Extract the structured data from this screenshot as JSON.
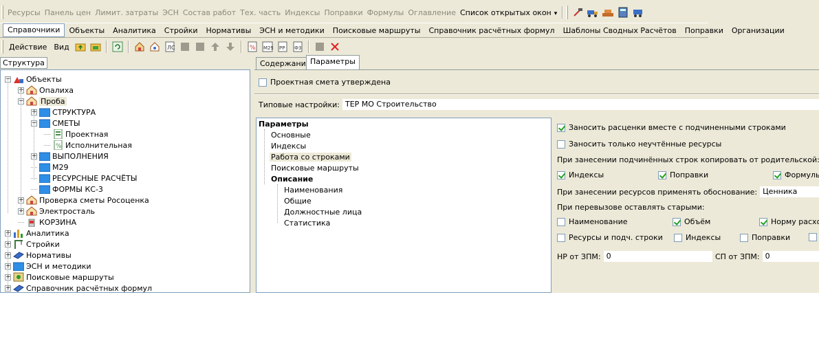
{
  "toolbar1": {
    "items": [
      "Ресурсы",
      "Панель цен",
      "Лимит. затраты",
      "ЭСН",
      "Состав работ",
      "Тех. часть",
      "Индексы",
      "Поправки",
      "Формулы",
      "Оглавление"
    ],
    "open_windows": "Список открытых окон"
  },
  "menu2": {
    "items": [
      "Справочники",
      "Объекты",
      "Аналитика",
      "Стройки",
      "Нормативы",
      "ЭСН и методики",
      "Поисковые маршруты",
      "Справочник расчётных формул",
      "Шаблоны Сводных Расчётов",
      "Поправки",
      "Организации"
    ]
  },
  "toolbar3": {
    "action": "Действие",
    "view": "Вид"
  },
  "left_tab": "Структура",
  "tree": [
    {
      "label": "Объекты",
      "level": 0,
      "exp": "-",
      "icon": "objects-icon"
    },
    {
      "label": "Опалиха",
      "level": 1,
      "exp": "+",
      "icon": "house-icon"
    },
    {
      "label": "Проба",
      "level": 1,
      "exp": "-",
      "icon": "house-icon",
      "selected": true
    },
    {
      "label": "СТРУКТУРА",
      "level": 2,
      "exp": "+",
      "icon": "folder-icon"
    },
    {
      "label": "СМЕТЫ",
      "level": 2,
      "exp": "-",
      "icon": "folder-icon"
    },
    {
      "label": "Проектная",
      "level": 3,
      "exp": "",
      "icon": "estimate-icon"
    },
    {
      "label": "Исполнительная",
      "level": 3,
      "exp": "",
      "icon": "estimate-exec-icon"
    },
    {
      "label": "ВЫПОЛНЕНИЯ",
      "level": 2,
      "exp": "+",
      "icon": "folder-icon"
    },
    {
      "label": "М29",
      "level": 2,
      "exp": "",
      "icon": "folder-icon"
    },
    {
      "label": "РЕСУРСНЫЕ РАСЧЁТЫ",
      "level": 2,
      "exp": "",
      "icon": "folder-icon"
    },
    {
      "label": "ФОРМЫ КС-3",
      "level": 2,
      "exp": "",
      "icon": "folder-icon"
    },
    {
      "label": "Проверка сметы Росоценка",
      "level": 1,
      "exp": "+",
      "icon": "house-icon"
    },
    {
      "label": "Электросталь",
      "level": 1,
      "exp": "+",
      "icon": "house-icon"
    },
    {
      "label": "КОРЗИНА",
      "level": 1,
      "exp": "",
      "icon": "trash-icon"
    },
    {
      "label": "Аналитика",
      "level": 0,
      "exp": "+",
      "icon": "chart-icon"
    },
    {
      "label": "Стройки",
      "level": 0,
      "exp": "+",
      "icon": "crane-icon"
    },
    {
      "label": "Нормативы",
      "level": 0,
      "exp": "+",
      "icon": "book-icon"
    },
    {
      "label": "ЭСН и методики",
      "level": 0,
      "exp": "+",
      "icon": "folder-icon"
    },
    {
      "label": "Поисковые маршруты",
      "level": 0,
      "exp": "+",
      "icon": "map-icon"
    },
    {
      "label": "Справочник расчётных формул",
      "level": 0,
      "exp": "+",
      "icon": "book-icon"
    }
  ],
  "tabs": {
    "content": "Содержание",
    "params": "Параметры"
  },
  "approved": {
    "label": "Проектная смета утверждена",
    "checked": false
  },
  "typical": {
    "label": "Типовые настройки:",
    "value": "ТЕР МО Строительство"
  },
  "ptree": {
    "root": "Параметры",
    "items": [
      "Основные",
      "Индексы",
      "Работа со строками",
      "Поисковые маршруты"
    ],
    "group": "Описание",
    "sub": [
      "Наименования",
      "Общие",
      "Должностные лица",
      "Статистика"
    ]
  },
  "rp": {
    "c1": {
      "label": "Заносить расценки вместе с подчиненными строками",
      "checked": true
    },
    "c2": {
      "label": "Заносить только неучтённые ресурсы",
      "checked": false
    },
    "copy_title": "При занесении подчинённых строк копировать от родительской:",
    "copy": [
      {
        "label": "Индексы",
        "checked": true
      },
      {
        "label": "Поправки",
        "checked": true
      },
      {
        "label": "Формулы",
        "checked": true
      }
    ],
    "basis_label": "При занесении ресурсов применять обоснование:",
    "basis_value": "Ценника",
    "keep_title": "При перевызове оставлять старыми:",
    "keep1": [
      {
        "label": "Наименование",
        "checked": false
      },
      {
        "label": "Объём",
        "checked": true
      },
      {
        "label": "Норму расхода",
        "checked": true
      }
    ],
    "keep2": [
      {
        "label": "Ресурсы и подч. строки",
        "checked": false
      },
      {
        "label": "Индексы",
        "checked": false
      },
      {
        "label": "Поправки",
        "checked": false
      },
      {
        "label": "",
        "checked": false
      }
    ],
    "hp_label": "НР от ЗПМ:",
    "hp_value": "0",
    "sp_label": "СП от ЗПМ:",
    "sp_value": "0"
  }
}
